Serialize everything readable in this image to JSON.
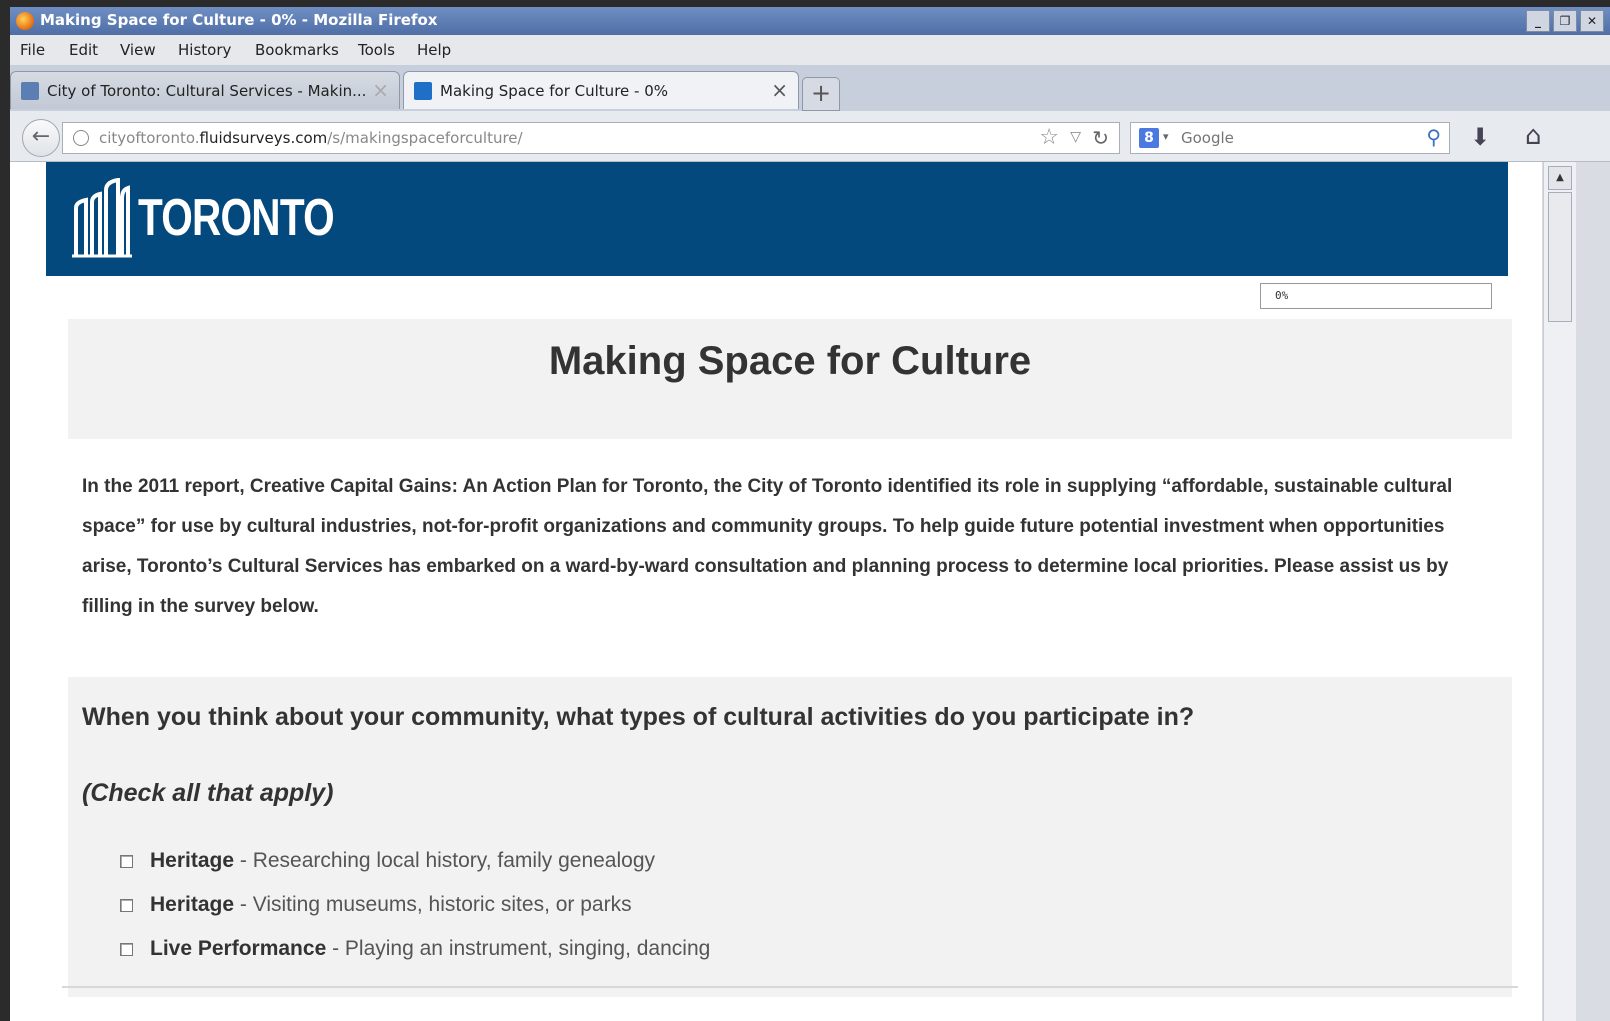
{
  "window": {
    "title": "Making Space for Culture - 0% - Mozilla Firefox",
    "controls": [
      "_",
      "❐",
      "✕"
    ]
  },
  "menu": [
    "File",
    "Edit",
    "View",
    "History",
    "Bookmarks",
    "Tools",
    "Help"
  ],
  "tabs": [
    {
      "label": "City of Toronto: Cultural Services - Makin...",
      "active": false
    },
    {
      "label": "Making Space for Culture - 0%",
      "active": true
    }
  ],
  "newtab_label": "+",
  "url": {
    "prefix": "cityoftoronto.",
    "domain": "fluidsurveys.com",
    "path": "/s/makingspaceforculture/"
  },
  "search": {
    "placeholder": "Google"
  },
  "page": {
    "brand": "TORONTO",
    "progress": "0%",
    "survey_title": "Making Space for Culture",
    "intro": "In the 2011 report, Creative Capital Gains: An Action Plan for Toronto, the City of Toronto identified its role in supplying “affordable, sustainable cultural space” for use by cultural industries, not-for-profit organizations and community groups. To help guide future potential investment when opportunities arise, Toronto’s Cultural Services has embarked on a ward-by-ward consultation and planning process to determine local priorities. Please assist us by filling in the survey below.",
    "question": "When you think about your community, what types of cultural activities do you participate in?",
    "instruction": "(Check all that apply)",
    "options": [
      {
        "name": "Heritage",
        "desc": " - Researching local history, family genealogy",
        "checked": false
      },
      {
        "name": "Heritage",
        "desc": " - Visiting museums, historic sites, or parks",
        "checked": false
      },
      {
        "name": "Live Performance",
        "desc": " - Playing an instrument, singing, dancing",
        "checked": false
      }
    ]
  },
  "colors": {
    "brand_blue": "#04497d",
    "panel_gray": "#f2f2f2",
    "titlebar": "#5a79b0"
  }
}
